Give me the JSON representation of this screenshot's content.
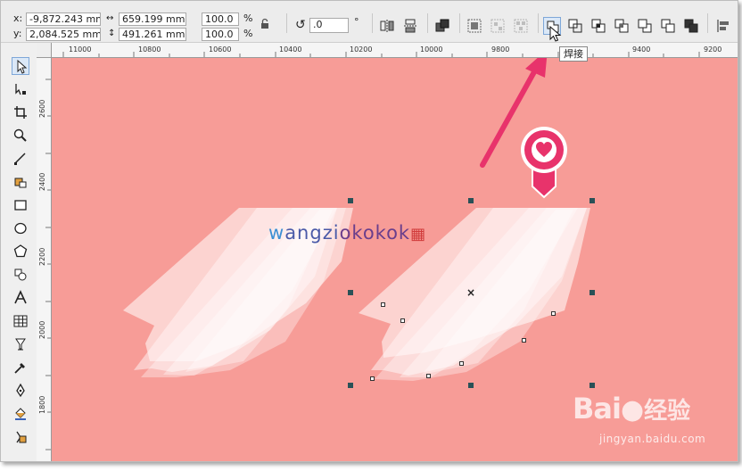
{
  "propbar": {
    "x_label": "x:",
    "x_value": "-9,872.243 mm",
    "y_label": "y:",
    "y_value": "2,084.525 mm",
    "width_value": "659.199 mm",
    "height_value": "491.261 mm",
    "scale_x": "100.0",
    "scale_y": "100.0",
    "percent": "%",
    "rotation_value": ".0",
    "degree": "°"
  },
  "tooltip": "焊接",
  "ruler_h": [
    "11000",
    "10800",
    "10600",
    "10400",
    "10200",
    "10000",
    "9800",
    "9600",
    "9400",
    "9200"
  ],
  "ruler_v": [
    "2600",
    "2400",
    "2200",
    "2000",
    "1800"
  ],
  "watermark": {
    "prefix": "w",
    "mid": "angzi",
    "suffix": "okokok",
    "brand": "Bai",
    "brand_cn": "经验",
    "url": "jingyan.baidu.com"
  },
  "colors": {
    "canvas": "#f79c97",
    "veil": "#ffffff",
    "accent_pink": "#e8336b",
    "handle": "#2a5157"
  },
  "icons": {
    "tools": [
      "pick-tool-icon",
      "shape-tool-icon",
      "crop-tool-icon",
      "zoom-tool-icon",
      "freehand-tool-icon",
      "smart-fill-tool-icon",
      "rectangle-tool-icon",
      "ellipse-tool-icon",
      "polygon-tool-icon",
      "basic-shapes-tool-icon",
      "text-tool-icon",
      "table-tool-icon",
      "blend-tool-icon",
      "eyedropper-tool-icon",
      "outline-pen-tool-icon",
      "fill-tool-icon",
      "interactive-fill-tool-icon"
    ]
  }
}
